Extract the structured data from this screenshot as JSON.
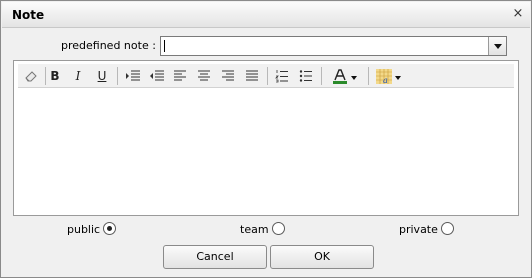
{
  "dialog": {
    "title": "Note",
    "close_symbol": "×"
  },
  "predefined": {
    "label": "predefined note :",
    "value": ""
  },
  "toolbar": {
    "bold": "B",
    "italic": "I",
    "underline": "U"
  },
  "visibility": {
    "options": [
      {
        "label": "public",
        "selected": true
      },
      {
        "label": "team",
        "selected": false
      },
      {
        "label": "private",
        "selected": false
      }
    ]
  },
  "buttons": {
    "cancel": "Cancel",
    "ok": "OK"
  }
}
